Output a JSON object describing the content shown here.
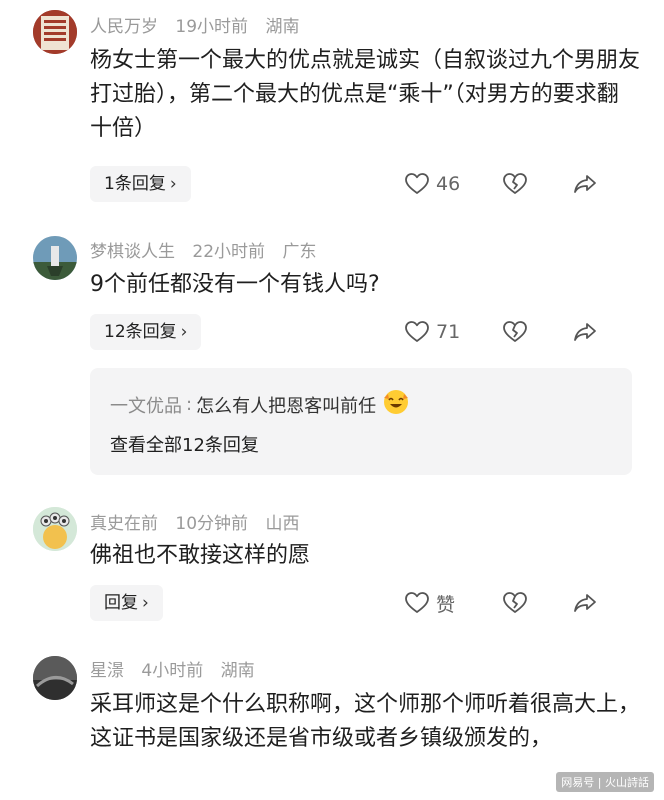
{
  "comments": [
    {
      "username": "人民万岁",
      "time": "19小时前",
      "location": "湖南",
      "text": "杨女士第一个最大的优点就是诚实（自叙谈过九个男朋友打过胎），第二个最大的优点是“乘十”（对男方的要求翻十倍）",
      "reply_label": "1条回复",
      "likes": "46"
    },
    {
      "username": "梦棋谈人生",
      "time": "22小时前",
      "location": "广东",
      "text": "9个前任都没有一个有钱人吗?",
      "reply_label": "12条回复",
      "likes": "71",
      "thread": {
        "user": "一文优品",
        "sep": ":",
        "text": "怎么有人把恩客叫前任",
        "more": "查看全部12条回复"
      }
    },
    {
      "username": "真史在前",
      "time": "10分钟前",
      "location": "山西",
      "text": "佛祖也不敢接这样的愿",
      "reply_label": "回复",
      "likes": "赞"
    },
    {
      "username": "星澋",
      "time": "4小时前",
      "location": "湖南",
      "text": "采耳师这是个什么职称啊，这个师那个师听着很高大上，这证书是国家级还是省市级或者乡镇级颁发的，"
    }
  ],
  "watermark": "网易号 | 火山詩話",
  "icons": {
    "like": "heart-outline-icon",
    "dislike": "broken-heart-icon",
    "share": "share-arrow-icon",
    "reply_chevron": "chevron-right-icon"
  },
  "colors": {
    "meta_text": "#9a9a9a",
    "reply_bg": "#f4f4f5",
    "body_text": "#1f1f1f"
  }
}
